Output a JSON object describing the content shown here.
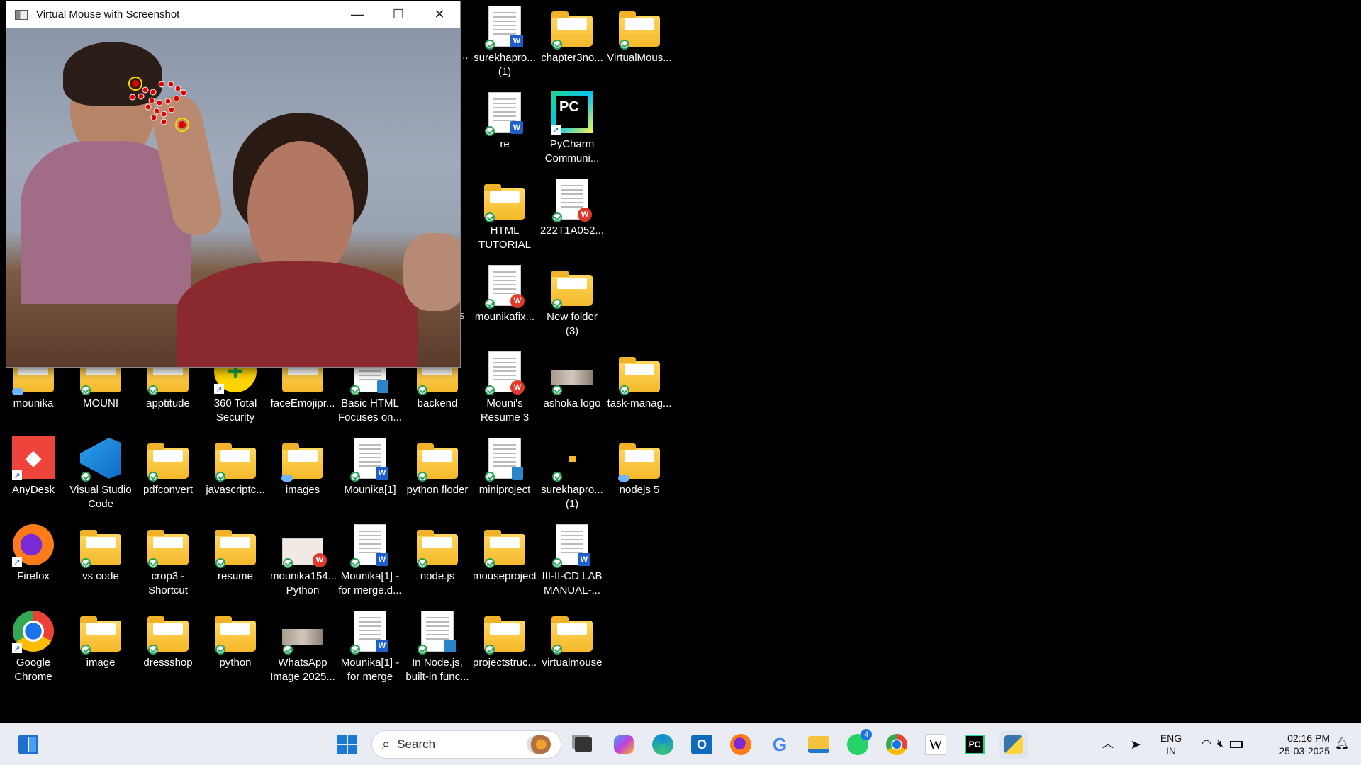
{
  "window": {
    "title": "Virtual Mouse with Screenshot",
    "controls": {
      "minimize": "—",
      "maximize": "☐",
      "close": "✕"
    }
  },
  "desktop_icons": [
    {
      "label": "surekhapro...\n(1)",
      "type": "doc-w",
      "sync": "check"
    },
    {
      "label": "chapter3no...",
      "type": "folder",
      "sync": "check"
    },
    {
      "label": "VirtualMous...",
      "type": "folder",
      "sync": "check"
    },
    {
      "label": "re",
      "type": "doc-w",
      "sync": "check"
    },
    {
      "label": "PyCharm\nCommuni...",
      "type": "pycharm",
      "sync": "shortcut"
    },
    {
      "label": "HTML\nTUTORIAL",
      "type": "folder",
      "sync": "check"
    },
    {
      "label": "222T1A052...",
      "type": "doc-wps",
      "sync": "check"
    },
    {
      "label": "mounikafix...",
      "type": "doc-wps",
      "sync": "check"
    },
    {
      "label": "New folder\n(3)",
      "type": "folder",
      "sync": "check"
    },
    {
      "label": "mounika",
      "type": "folder",
      "sync": "cloud"
    },
    {
      "label": "MOUNI",
      "type": "folder",
      "sync": "check"
    },
    {
      "label": "apptitude",
      "type": "folder",
      "sync": "check"
    },
    {
      "label": "360 Total\nSecurity",
      "type": "360",
      "sync": "shortcut"
    },
    {
      "label": "faceEmojipr...",
      "type": "folder",
      "sync": "none"
    },
    {
      "label": "Basic HTML\nFocuses on...",
      "type": "doc-sheet",
      "sync": "check"
    },
    {
      "label": "backend",
      "type": "folder",
      "sync": "check"
    },
    {
      "label": "Mouni's\nResume 3",
      "type": "doc-wps",
      "sync": "check"
    },
    {
      "label": "ashoka logo",
      "type": "image",
      "sync": "check"
    },
    {
      "label": "task-manag...",
      "type": "folder",
      "sync": "check"
    },
    {
      "label": "AnyDesk",
      "type": "anydesk",
      "sync": "shortcut"
    },
    {
      "label": "Visual Studio\nCode",
      "type": "vscode",
      "sync": "check"
    },
    {
      "label": "pdfconvert",
      "type": "folder",
      "sync": "check"
    },
    {
      "label": "javascriptc...",
      "type": "folder",
      "sync": "check"
    },
    {
      "label": "images",
      "type": "folder",
      "sync": "cloud"
    },
    {
      "label": "Mounika[1]",
      "type": "doc-w",
      "sync": "check"
    },
    {
      "label": "python floder",
      "type": "folder",
      "sync": "check"
    },
    {
      "label": "miniproject",
      "type": "doc-sheet",
      "sync": "check"
    },
    {
      "label": "surekhapro...\n(1)",
      "type": "tiny",
      "sync": "check"
    },
    {
      "label": "nodejs 5",
      "type": "folder",
      "sync": "cloud"
    },
    {
      "label": "Firefox",
      "type": "firefox",
      "sync": "shortcut"
    },
    {
      "label": "vs code",
      "type": "folder",
      "sync": "check"
    },
    {
      "label": "crop3 -\nShortcut",
      "type": "folder",
      "sync": "check"
    },
    {
      "label": "resume",
      "type": "folder",
      "sync": "check"
    },
    {
      "label": "mounika154...\nPython",
      "type": "image-wps",
      "sync": "check"
    },
    {
      "label": "Mounika[1] -\nfor merge.d...",
      "type": "doc-w",
      "sync": "check"
    },
    {
      "label": "node.js",
      "type": "folder",
      "sync": "check"
    },
    {
      "label": "mouseproject",
      "type": "folder",
      "sync": "check"
    },
    {
      "label": "III-II-CD LAB\nMANUAL-...",
      "type": "doc-w",
      "sync": "check"
    },
    {
      "label": "Google\nChrome",
      "type": "chrome",
      "sync": "shortcut"
    },
    {
      "label": "image",
      "type": "folder",
      "sync": "check"
    },
    {
      "label": "dressshop",
      "type": "folder",
      "sync": "check"
    },
    {
      "label": "python",
      "type": "folder",
      "sync": "check"
    },
    {
      "label": "WhatsApp\nImage 2025...",
      "type": "image",
      "sync": "check"
    },
    {
      "label": "Mounika[1] -\nfor merge",
      "type": "doc-w",
      "sync": "check"
    },
    {
      "label": "In Node.js,\nbuilt-in func...",
      "type": "doc-sheet",
      "sync": "check"
    },
    {
      "label": "projectstruc...",
      "type": "folder",
      "sync": "check"
    },
    {
      "label": "virtualmouse",
      "type": "folder",
      "sync": "check"
    }
  ],
  "partial_labels": [
    "...",
    "s"
  ],
  "taskbar": {
    "search_placeholder": "Search",
    "whatsapp_badge": "4",
    "language": "ENG",
    "region": "IN",
    "time": "02:16 PM",
    "date": "25-03-2025",
    "apps": [
      "widgets",
      "start",
      "search",
      "task-view",
      "copilot",
      "edge",
      "outlook",
      "firefox",
      "google",
      "file-explorer",
      "whatsapp",
      "chrome",
      "wikipedia",
      "pycharm",
      "python"
    ]
  },
  "colors": {
    "taskbar_bg": "#e9edf3",
    "folder": "#f5b82a",
    "landmark_dot": "#e00000",
    "landmark_ring": "#ffd800"
  }
}
